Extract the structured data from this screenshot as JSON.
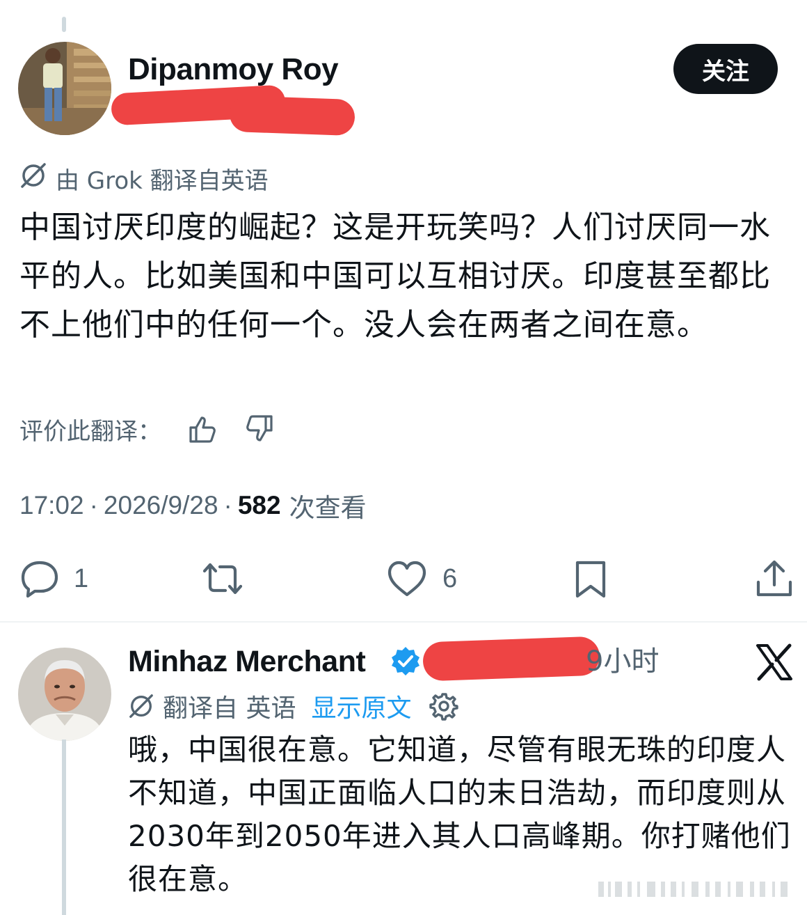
{
  "post": {
    "author_name": "Dipanmoy Roy",
    "follow_label": "关注",
    "translated_by": "由 Grok 翻译自英语",
    "text": "中国讨厌印度的崛起？这是开玩笑吗？人们讨厌同一水平的人。比如美国和中国可以互相讨厌。印度甚至都比不上他们中的任何一个。没人会在两者之间在意。",
    "rate_label": "评价此翻译：",
    "time": "17:02",
    "date": "2026/9/28",
    "separator": "·",
    "views_count": "582",
    "views_label": "次查看",
    "actions": {
      "reply_count": "1",
      "like_count": "6"
    }
  },
  "reply": {
    "author_name": "Minhaz Merchant",
    "age": "9小时",
    "translated_from": "翻译自 英语",
    "show_original": "显示原文",
    "text": "哦，中国很在意。它知道，尽管有眼无珠的印度人不知道，中国正面临人口的末日浩劫，而印度则从2030年到2050年进入其人口高峰期。你打赌他们很在意。"
  },
  "colors": {
    "text_primary": "#0f1419",
    "text_secondary": "#536471",
    "link_blue": "#1d9bf0",
    "verified_blue": "#1d9bf0",
    "redaction_red": "#ee4444",
    "follow_button": "#0f1419"
  },
  "icons": [
    "translate-icon",
    "thumbs-up-icon",
    "thumbs-down-icon",
    "reply-icon",
    "retweet-icon",
    "like-icon",
    "bookmark-icon",
    "share-icon",
    "verified-badge-icon",
    "settings-gear-icon",
    "x-logo-icon"
  ]
}
